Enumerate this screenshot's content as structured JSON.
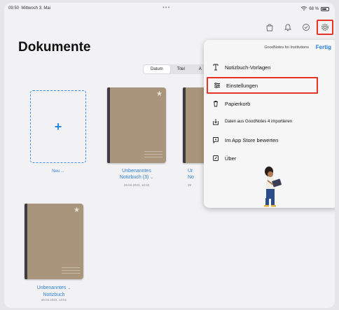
{
  "status_bar": {
    "time": "09:50",
    "date": "Mittwoch 3. Mai",
    "battery": "68 %"
  },
  "page": {
    "title": "Dokumente"
  },
  "sort": {
    "options": [
      "Datum",
      "Titel",
      "A"
    ],
    "selected": "Datum"
  },
  "new_item": {
    "icon": "+",
    "label": "Neu ..."
  },
  "notebooks": [
    {
      "title_line1": "Unbenanntes",
      "title_line2": "Notizbuch (3)",
      "date": "29.04.2023, 12:02"
    },
    {
      "title_line1": "Ur",
      "title_line2": "No",
      "date": "29"
    },
    {
      "title_line1": "Unbenanntes",
      "title_line2": "Notizbuch",
      "date": "29.04.2023, 13:01"
    }
  ],
  "menu": {
    "header_subtitle": "GoodNotes for Institutions",
    "done_label": "Fertig",
    "items": [
      {
        "label": "Notizbuch-Vorlagen",
        "icon": "template-icon"
      },
      {
        "label": "Einstellungen",
        "icon": "sliders-icon"
      },
      {
        "label": "Papierkorb",
        "icon": "trash-icon"
      },
      {
        "label": "Daten aus GoodNotes 4 importieren",
        "icon": "import-icon"
      },
      {
        "label": "Im App Store bewerten",
        "icon": "feedback-icon"
      },
      {
        "label": "Über",
        "icon": "info-icon"
      }
    ]
  },
  "colors": {
    "accent": "#2a7fe0",
    "highlight": "#e53326",
    "notebook_cover": "#a9957b"
  }
}
